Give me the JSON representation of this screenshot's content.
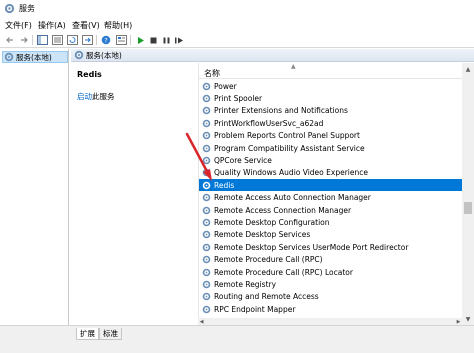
{
  "window": {
    "title": "服务"
  },
  "menu": [
    "文件(F)",
    "操作(A)",
    "查看(V)",
    "帮助(H)"
  ],
  "toolbar": {
    "icons": [
      "back-arrow-icon",
      "forward-arrow-icon",
      "console-tree-icon",
      "list-view-icon",
      "refresh-icon",
      "export-list-icon",
      "help-icon",
      "properties-icon",
      "start-service-icon",
      "stop-service-icon",
      "pause-service-icon",
      "restart-service-icon"
    ]
  },
  "tree": {
    "root_label": "服务(本地)"
  },
  "panel": {
    "header_label": "服务(本地)"
  },
  "detail": {
    "service_name": "Redis",
    "start_link": "启动",
    "start_suffix": "此服务"
  },
  "list": {
    "column_name": "名称",
    "items": [
      "Power",
      "Print Spooler",
      "Printer Extensions and Notifications",
      "PrintWorkflowUserSvc_a62ad",
      "Problem Reports Control Panel Support",
      "Program Compatibility Assistant Service",
      "QPCore Service",
      "Quality Windows Audio Video Experience",
      "Redis",
      "Remote Access Auto Connection Manager",
      "Remote Access Connection Manager",
      "Remote Desktop Configuration",
      "Remote Desktop Services",
      "Remote Desktop Services UserMode Port Redirector",
      "Remote Procedure Call (RPC)",
      "Remote Procedure Call (RPC) Locator",
      "Remote Registry",
      "Routing and Remote Access",
      "RPC Endpoint Mapper"
    ],
    "selected": "Redis"
  },
  "tabs": [
    "扩展",
    "标准"
  ],
  "colors": {
    "selection": "#0078d7",
    "link": "#0066cc",
    "annotation_arrow": "#d9252b",
    "play_green": "#1a9e2a"
  }
}
